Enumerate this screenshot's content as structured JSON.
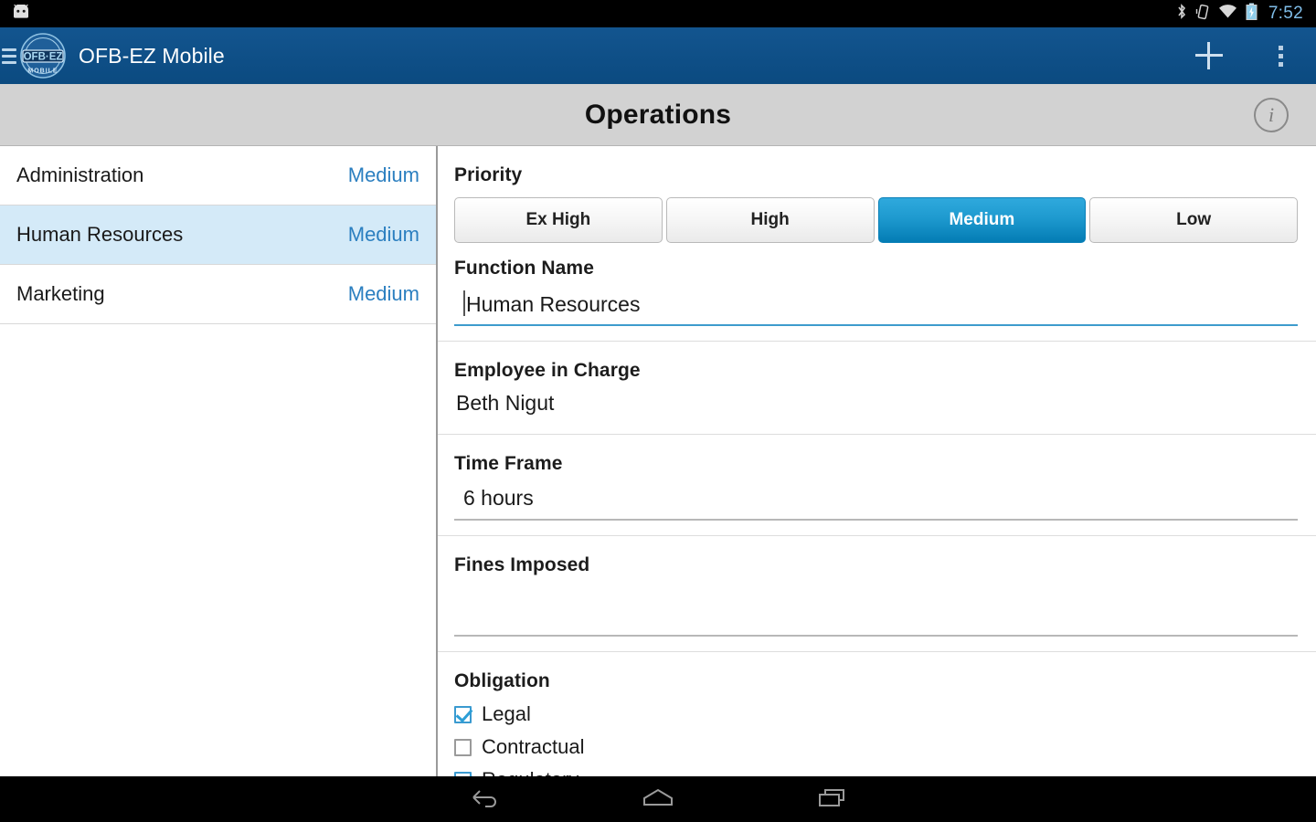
{
  "statusbar": {
    "time": "7:52",
    "icons": [
      "android-head-icon",
      "bluetooth-icon",
      "vibrate-icon",
      "wifi-icon",
      "battery-charging-icon"
    ]
  },
  "appbar": {
    "menu_icon": "hamburger-menu-icon",
    "logo_primary": "OFB·EZ",
    "logo_sub": "MOBILE",
    "title": "OFB-EZ Mobile",
    "add_icon": "plus-icon",
    "overflow_icon": "overflow-menu-icon"
  },
  "pageheader": {
    "title": "Operations",
    "info_icon": "info-icon",
    "info_glyph": "i"
  },
  "list": {
    "items": [
      {
        "name": "Administration",
        "priority": "Medium",
        "selected": false
      },
      {
        "name": "Human Resources",
        "priority": "Medium",
        "selected": true
      },
      {
        "name": "Marketing",
        "priority": "Medium",
        "selected": false
      }
    ]
  },
  "detail": {
    "priority": {
      "label": "Priority",
      "options": [
        "Ex High",
        "High",
        "Medium",
        "Low"
      ],
      "selected": "Medium"
    },
    "function_name": {
      "label": "Function Name",
      "value": "Human Resources",
      "placeholder": "",
      "focused": true
    },
    "employee_in_charge": {
      "label": "Employee in Charge",
      "value": "Beth Nigut"
    },
    "time_frame": {
      "label": "Time Frame",
      "value": "6 hours",
      "placeholder": ""
    },
    "fines_imposed": {
      "label": "Fines Imposed",
      "value": "",
      "placeholder": ""
    },
    "obligation": {
      "label": "Obligation",
      "options": [
        {
          "label": "Legal",
          "checked": true
        },
        {
          "label": "Contractual",
          "checked": false
        },
        {
          "label": "Regulatory",
          "checked": true
        }
      ]
    }
  },
  "navbar": {
    "buttons": [
      "back-icon",
      "home-icon",
      "recents-icon"
    ]
  },
  "colors": {
    "appbar_blue": "#0d4e87",
    "accent_blue": "#2b7fc0",
    "selected_row": "#d4eaf8",
    "segment_active": "#1e9acf",
    "header_gray": "#d2d2d2",
    "clock_blue": "#7fbde8"
  }
}
